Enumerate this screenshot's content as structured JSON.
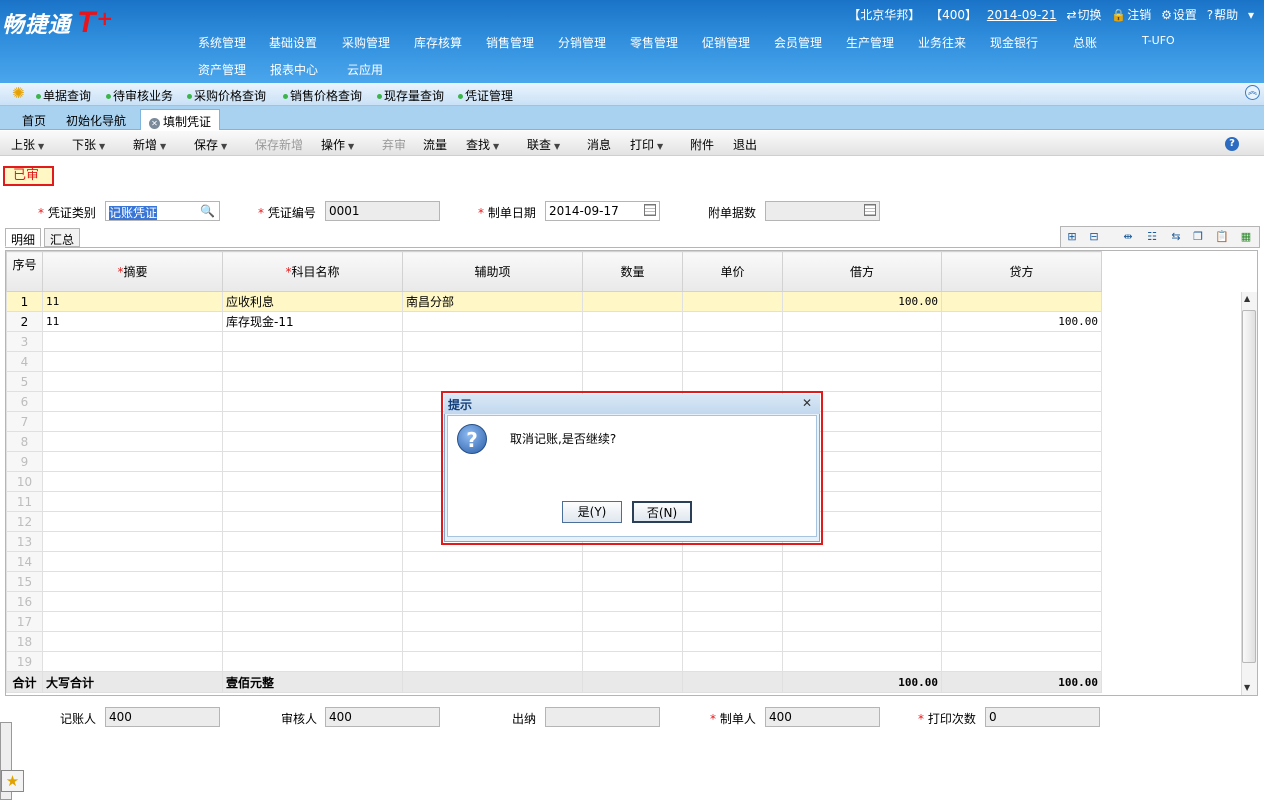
{
  "header": {
    "logo_text": "畅捷通",
    "logo_t": "T",
    "logo_plus": "+",
    "menu_row1": [
      "系统管理",
      "基础设置",
      "采购管理",
      "库存核算",
      "销售管理",
      "分销管理",
      "零售管理",
      "促销管理",
      "会员管理",
      "生产管理",
      "业务往来",
      "现金银行",
      "总账",
      "T-UFO"
    ],
    "menu_row2": [
      "资产管理",
      "报表中心",
      "云应用"
    ],
    "company": "【北京华邦】",
    "user": "【400】",
    "date": "2014-09-21",
    "switch_label": "切换",
    "logout_label": "注销",
    "settings_label": "设置",
    "help_label": "帮助"
  },
  "quickbar": [
    "单据查询",
    "待审核业务",
    "采购价格查询",
    "销售价格查询",
    "现存量查询",
    "凭证管理"
  ],
  "tabs": {
    "home": "首页",
    "init": "初始化导航",
    "current": "填制凭证"
  },
  "toolbar": {
    "prev": "上张",
    "next": "下张",
    "new": "新增",
    "save": "保存",
    "save_new": "保存新增",
    "operate": "操作",
    "discard": "弃审",
    "flow": "流量",
    "find": "查找",
    "linkq": "联查",
    "message": "消息",
    "print": "打印",
    "attach": "附件",
    "exit": "退出"
  },
  "voucher": {
    "status": "已审",
    "type_label": "凭证类别",
    "type_value": "记账凭证",
    "no_label": "凭证编号",
    "no_value": "0001",
    "date_label": "制单日期",
    "date_value": "2014-09-17",
    "attach_label": "附单据数",
    "attach_value": ""
  },
  "grid_tabs": {
    "detail": "明细",
    "summary": "汇总"
  },
  "table": {
    "headers": [
      "序号",
      "摘要",
      "科目名称",
      "辅助项",
      "数量",
      "单价",
      "借方",
      "贷方"
    ],
    "rows": [
      {
        "no": "1",
        "summary": "11",
        "account": "应收利息",
        "aux": "南昌分部",
        "qty": "",
        "price": "",
        "debit": "100.00",
        "credit": ""
      },
      {
        "no": "2",
        "summary": "11",
        "account": "库存现金-11",
        "aux": "",
        "qty": "",
        "price": "",
        "debit": "",
        "credit": "100.00"
      }
    ],
    "empty_rows": [
      "3",
      "4",
      "5",
      "6",
      "7",
      "8",
      "9",
      "10",
      "11",
      "12",
      "13",
      "14",
      "15",
      "16",
      "17",
      "18",
      "19"
    ],
    "total": {
      "label": "合计",
      "caps_label": "大写合计",
      "caps_value": "壹佰元整",
      "debit": "100.00",
      "credit": "100.00"
    }
  },
  "footer": {
    "poster_label": "记账人",
    "poster_value": "400",
    "auditor_label": "审核人",
    "auditor_value": "400",
    "cashier_label": "出纳",
    "cashier_value": "",
    "maker_label": "制单人",
    "maker_value": "400",
    "prints_label": "打印次数",
    "prints_value": "0"
  },
  "dialog": {
    "title": "提示",
    "message": "取消记账,是否继续?",
    "yes": "是(Y)",
    "no": "否(N)"
  }
}
